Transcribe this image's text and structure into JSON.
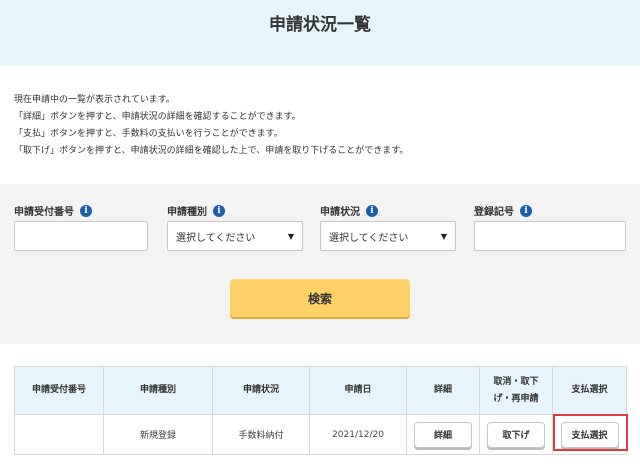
{
  "header": {
    "title": "申請状況一覧"
  },
  "description": [
    "現在申請中の一覧が表示されています。",
    "「詳細」ボタンを押すと、申請状況の詳細を確認することができます。",
    "「支払」ボタンを押すと、手数料の支払いを行うことができます。",
    "「取下げ」ボタンを押すと、申請状況の詳細を確認した上で、申請を取り下げることができます。"
  ],
  "search": {
    "fields": [
      {
        "label": "申請受付番号",
        "value": "",
        "info_icon": "i"
      },
      {
        "label": "申請種別",
        "selected": "選択してください",
        "info_icon": "i"
      },
      {
        "label": "申請状況",
        "selected": "選択してください",
        "info_icon": "i"
      },
      {
        "label": "登録記号",
        "value": "",
        "info_icon": "i"
      }
    ],
    "button_label": "検索"
  },
  "table": {
    "headers": [
      "申請受付番号",
      "申請種別",
      "申請状況",
      "申請日",
      "詳細",
      "取消・取下げ・再申請",
      "支払選択"
    ],
    "rows": [
      {
        "number": "",
        "type": "新規登録",
        "status": "手数料納付",
        "date": "2021/12/20",
        "detail_button": "詳細",
        "withdraw_button": "取下げ",
        "pay_button": "支払選択"
      }
    ]
  },
  "colors": {
    "header_bg": "#e8f4fb",
    "search_button": "#ffd166",
    "info_icon": "#1a5fa8",
    "highlight": "#e0393e"
  }
}
